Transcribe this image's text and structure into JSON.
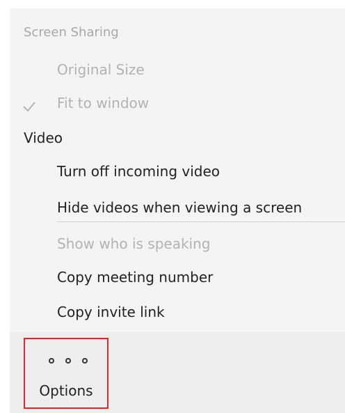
{
  "menu": {
    "screen_sharing": "Screen Sharing",
    "original_size": "Original Size",
    "fit_to_window": "Fit to window",
    "video": "Video",
    "turn_off_incoming_video": "Turn off incoming video",
    "hide_videos": "Hide videos when viewing a screen",
    "show_who_is_speaking": "Show who is speaking",
    "copy_meeting_number": "Copy meeting number",
    "copy_invite_link": "Copy invite link"
  },
  "bottom_bar": {
    "options_label": "Options",
    "options_icon": "more-horizontal-icon"
  },
  "colors": {
    "highlight_border": "#e0262e",
    "menu_background": "#f4f4f4",
    "disabled_text": "#b3b3b3"
  }
}
